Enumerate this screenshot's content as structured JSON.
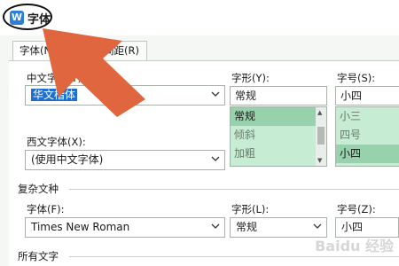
{
  "window": {
    "title": "字体",
    "app_icon": "W"
  },
  "tabs": [
    {
      "label": "字体(N)"
    },
    {
      "label": "字符间距(R)"
    }
  ],
  "chinese_font": {
    "label": "中文字体(T):",
    "value": "华文楷体"
  },
  "western_font": {
    "label": "西文字体(X):",
    "value": "(使用中文字体)"
  },
  "font_style": {
    "label": "字形(Y):",
    "value": "常规",
    "options": [
      "常规",
      "倾斜",
      "加粗"
    ]
  },
  "font_size": {
    "label": "字号(S):",
    "value": "小四",
    "options": [
      "小三",
      "四号",
      "小四"
    ]
  },
  "complex_script": {
    "section": "复杂文种",
    "font_label": "字体(F):",
    "font_value": "Times New Roman",
    "style_label": "字形(L):",
    "style_value": "常规",
    "size_label": "字号(Z):",
    "size_value": "小四"
  },
  "all_text": {
    "section": "所有文字"
  },
  "watermark": "Baidu 经验",
  "colors": {
    "arrow": "#e0663f",
    "selection": "#1f6fd1",
    "list_bg": "#c6ecd3",
    "list_selected": "#98d2ac"
  },
  "icons": {
    "dropdown": "chevron-down-icon",
    "annotation": "arrow-pointer-icon"
  }
}
